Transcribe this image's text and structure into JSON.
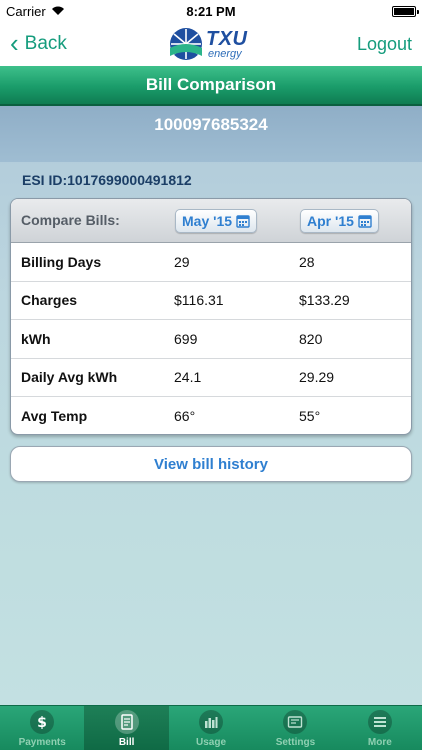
{
  "status": {
    "carrier": "Carrier",
    "time": "8:21 PM"
  },
  "nav": {
    "back_label": "Back",
    "logout_label": "Logout",
    "logo_brand": "TXU",
    "logo_sub": "energy"
  },
  "page": {
    "title": "Bill Comparison",
    "account_number": "100097685324",
    "esi_id": "ESI ID:1017699000491812"
  },
  "compare": {
    "header_label": "Compare Bills:",
    "date1": "May '15",
    "date2": "Apr '15",
    "rows": [
      {
        "label": "Billing Days",
        "v1": "29",
        "v2": "28"
      },
      {
        "label": "Charges",
        "v1": "$116.31",
        "v2": "$133.29"
      },
      {
        "label": "kWh",
        "v1": "699",
        "v2": "820"
      },
      {
        "label": "Daily Avg kWh",
        "v1": "24.1",
        "v2": "29.29"
      },
      {
        "label": "Avg Temp",
        "v1": "66°",
        "v2": "55°"
      }
    ]
  },
  "history_button": "View bill history",
  "tabs": [
    {
      "label": "Payments",
      "icon": "dollar-icon"
    },
    {
      "label": "Bill",
      "icon": "bill-icon"
    },
    {
      "label": "Usage",
      "icon": "usage-icon"
    },
    {
      "label": "Settings",
      "icon": "settings-icon"
    },
    {
      "label": "More",
      "icon": "more-icon"
    }
  ],
  "colors": {
    "accent": "#159c7d",
    "link": "#2f7fd0",
    "titlebar": "#1a9c6a"
  }
}
